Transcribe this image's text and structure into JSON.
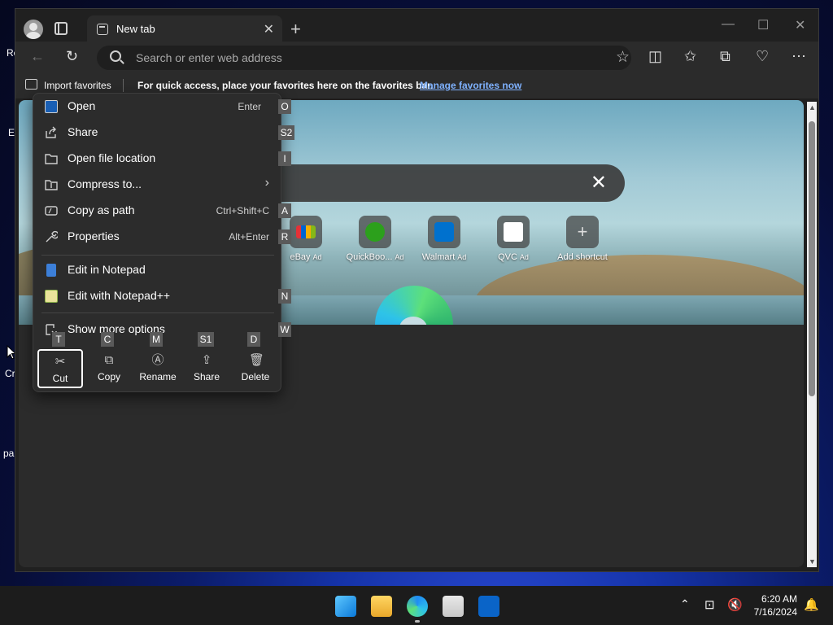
{
  "browser": {
    "tab_title": "New tab",
    "address_placeholder": "Search or enter web address",
    "favbar": {
      "import_label": "Import favorites",
      "message": "For quick access, place your favorites here on the favorites bar.",
      "link": "Manage favorites now"
    },
    "shortcuts": [
      {
        "label": "eBay",
        "ad": "Ad"
      },
      {
        "label": "QuickBoo...",
        "ad": "Ad"
      },
      {
        "label": "Walmart",
        "ad": "Ad"
      },
      {
        "label": "QVC",
        "ad": "Ad"
      },
      {
        "label": "Add shortcut",
        "ad": ""
      }
    ]
  },
  "context_menu": {
    "items": [
      {
        "label": "Open",
        "shortcut": "Enter",
        "access_key": "O"
      },
      {
        "label": "Share",
        "shortcut": "",
        "access_key": "S2"
      },
      {
        "label": "Open file location",
        "shortcut": "",
        "access_key": "I"
      },
      {
        "label": "Compress to...",
        "shortcut": "",
        "access_key": ""
      },
      {
        "label": "Copy as path",
        "shortcut": "Ctrl+Shift+C",
        "access_key": "A"
      },
      {
        "label": "Properties",
        "shortcut": "Alt+Enter",
        "access_key": "R"
      },
      {
        "label": "Edit in Notepad",
        "shortcut": "",
        "access_key": ""
      },
      {
        "label": "Edit with Notepad++",
        "shortcut": "",
        "access_key": "N"
      },
      {
        "label": "Show more options",
        "shortcut": "",
        "access_key": "W"
      }
    ],
    "quick_actions": [
      {
        "label": "Cut",
        "access_key": "T"
      },
      {
        "label": "Copy",
        "access_key": "C"
      },
      {
        "label": "Rename",
        "access_key": "M"
      },
      {
        "label": "Share",
        "access_key": "S1"
      },
      {
        "label": "Delete",
        "access_key": "D"
      }
    ]
  },
  "desktop_fragments": [
    "Re",
    "E",
    "Cr",
    "pa"
  ],
  "taskbar": {
    "time": "6:20 AM",
    "date": "7/16/2024"
  },
  "colors": {
    "accent_link": "#7fb2ff",
    "menu_bg": "#2c2c2c",
    "chrome_bg": "#2b2b2b"
  }
}
